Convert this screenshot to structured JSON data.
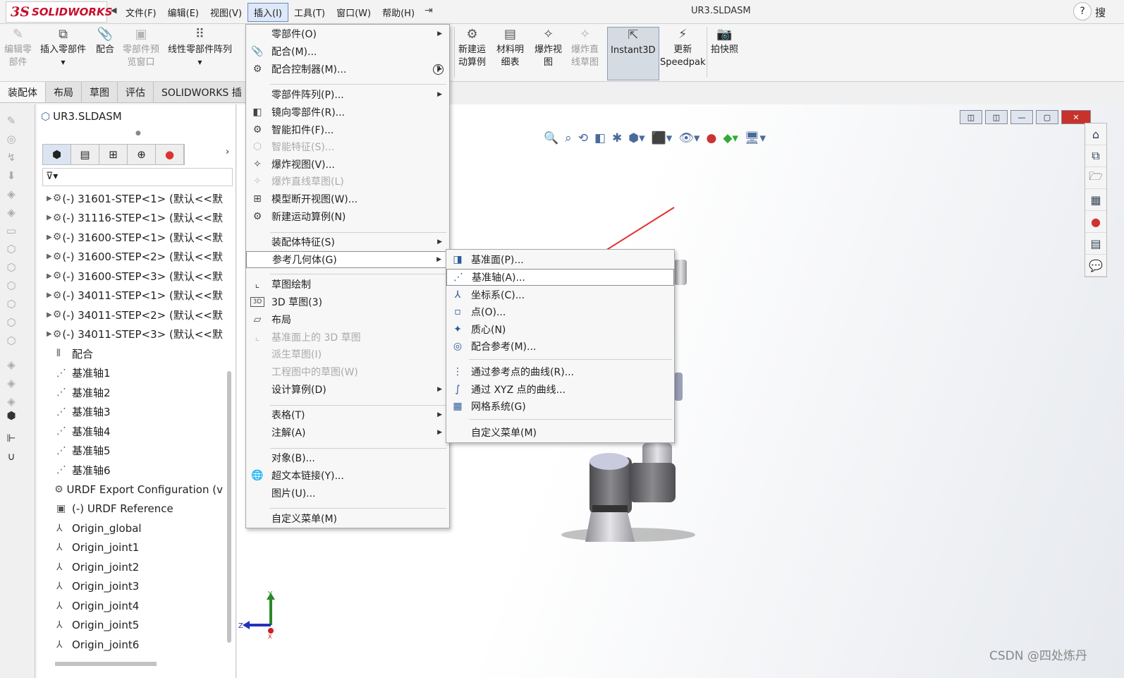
{
  "app": {
    "logo_ds": "3S",
    "logo_text": "SOLIDWORKS",
    "title": "UR3.SLDASM",
    "help": "?",
    "search": "搜"
  },
  "menubar": [
    "文件(F)",
    "编辑(E)",
    "视图(V)",
    "插入(I)",
    "工具(T)",
    "窗口(W)",
    "帮助(H)"
  ],
  "toolbar": {
    "edit_component": [
      "编辑零",
      "部件"
    ],
    "insert_components": "插入零部件",
    "mate": "配合",
    "component_preview": [
      "零部件预",
      "览窗口"
    ],
    "linear_pattern": "线性零部件阵列",
    "new_motion_study": [
      "新建运",
      "动算例"
    ],
    "bom": [
      "材料明",
      "细表"
    ],
    "exploded_view": [
      "爆炸视",
      "图"
    ],
    "explode_line": [
      "爆炸直",
      "线草图"
    ],
    "instant3d": "Instant3D",
    "speedpak": [
      "更新",
      "Speedpak"
    ],
    "snapshot": "拍快照"
  },
  "tabs": [
    "装配体",
    "布局",
    "草图",
    "评估",
    "SOLIDWORKS 插"
  ],
  "tree": {
    "title": "UR3.SLDASM",
    "filter_icon": "filter-icon",
    "items": [
      "(-) 31601-STEP<1> (默认<<默",
      "(-) 31116-STEP<1> (默认<<默",
      "(-) 31600-STEP<1> (默认<<默",
      "(-) 31600-STEP<2> (默认<<默",
      "(-) 31600-STEP<3> (默认<<默",
      "(-) 34011-STEP<1> (默认<<默",
      "(-) 34011-STEP<2> (默认<<默",
      "(-) 34011-STEP<3> (默认<<默",
      "配合",
      "基准轴1",
      "基准轴2",
      "基准轴3",
      "基准轴4",
      "基准轴5",
      "基准轴6",
      "URDF Export Configuration (v",
      "(-) URDF Reference",
      "Origin_global",
      "Origin_joint1",
      "Origin_joint2",
      "Origin_joint3",
      "Origin_joint4",
      "Origin_joint5",
      "Origin_joint6"
    ]
  },
  "insert_menu": [
    "零部件(O)",
    "配合(M)...",
    "配合控制器(M)...",
    "零部件阵列(P)...",
    "镜向零部件(R)...",
    "智能扣件(F)...",
    "智能特征(S)...",
    "爆炸视图(V)...",
    "爆炸直线草图(L)",
    "模型断开视图(W)...",
    "新建运动算例(N)",
    "装配体特征(S)",
    "参考几何体(G)",
    "草图绘制",
    "3D 草图(3)",
    "布局",
    "基准面上的 3D 草图",
    "派生草图(I)",
    "工程图中的草图(W)",
    "设计算例(D)",
    "表格(T)",
    "注解(A)",
    "对象(B)...",
    "超文本链接(Y)...",
    "图片(U)...",
    "自定义菜单(M)"
  ],
  "ref_geometry_menu": [
    "基准面(P)...",
    "基准轴(A)...",
    "坐标系(C)...",
    "点(O)...",
    "质心(N)",
    "配合参考(M)...",
    "通过参考点的曲线(R)...",
    "通过 XYZ 点的曲线...",
    "网格系统(G)",
    "自定义菜单(M)"
  ],
  "triad": {
    "y": "Y",
    "z": "Z",
    "x": "X"
  },
  "watermark": "CSDN @四处炼丹",
  "colors": {
    "brand": "#c8102e",
    "annotation_arrow": "#e0342e",
    "highlight": "#8e8e8e"
  }
}
